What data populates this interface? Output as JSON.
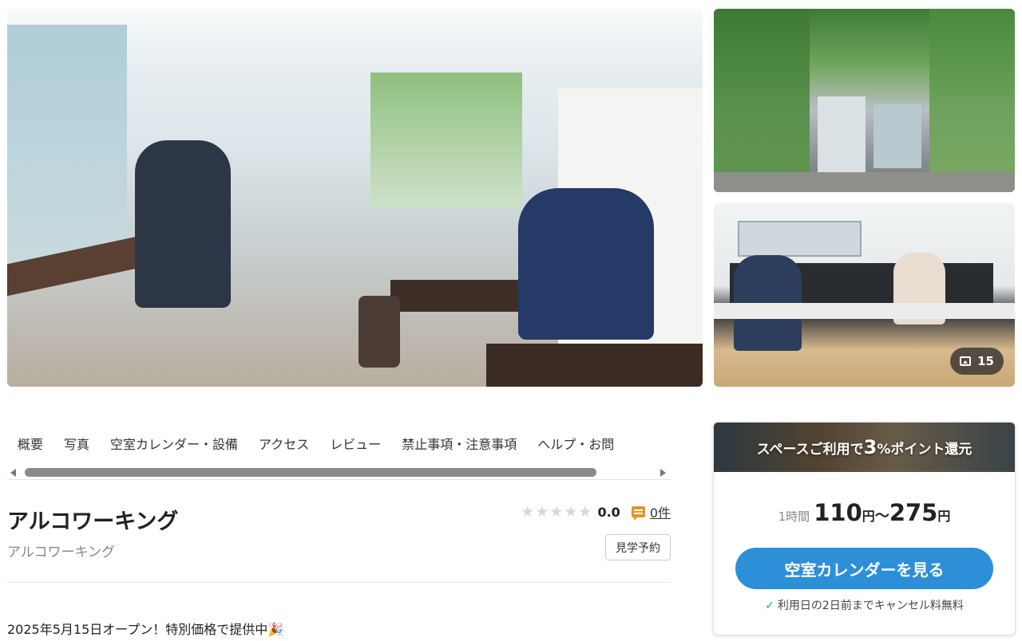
{
  "gallery": {
    "photo_count": "15"
  },
  "tabs": [
    {
      "label": "概要"
    },
    {
      "label": "写真"
    },
    {
      "label": "空室カレンダー・設備"
    },
    {
      "label": "アクセス"
    },
    {
      "label": "レビュー"
    },
    {
      "label": "禁止事項・注意事項"
    },
    {
      "label": "ヘルプ・お問"
    }
  ],
  "space": {
    "title": "アルコワーキング",
    "subtitle": "アルコワーキング",
    "rating_score": "0.0",
    "review_count": "0件",
    "tour_button_label": "見学予約",
    "stars": "★★★★★"
  },
  "announcement": "2025年5月15日オープン！特別価格で提供中🎉",
  "booking": {
    "promo_prefix": "スペースご利用で",
    "promo_highlight": "3",
    "promo_suffix": "%ポイント還元",
    "price_unit": "1時間",
    "price_min": "110",
    "price_max": "275",
    "yen": "円",
    "tilde": "〜",
    "calendar_button_label": "空室カレンダーを見る",
    "cancel_note": "利用日の2日前までキャンセル料無料"
  },
  "colors": {
    "accent": "#2d8fd8",
    "review_icon": "#e0962b",
    "star_empty": "#d8d8d8"
  }
}
